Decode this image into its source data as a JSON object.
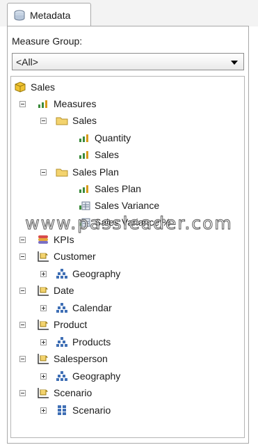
{
  "tab": {
    "label": "Metadata",
    "icon": "cube-stack-icon"
  },
  "measure_group": {
    "label": "Measure Group:",
    "selected": "<All>"
  },
  "tree": {
    "cube": "Sales",
    "measures": "Measures",
    "sales_folder": "Sales",
    "quantity": "Quantity",
    "sales_measure": "Sales",
    "sales_plan_folder": "Sales Plan",
    "sales_plan_measure": "Sales Plan",
    "sales_variance": "Sales Variance",
    "sales_variance_pct": "Sales Variance %",
    "kpis": "KPIs",
    "customer": "Customer",
    "customer_geography": "Geography",
    "date": "Date",
    "calendar": "Calendar",
    "product": "Product",
    "products": "Products",
    "salesperson": "Salesperson",
    "salesperson_geography": "Geography",
    "scenario": "Scenario",
    "scenario_attr": "Scenario"
  },
  "watermark": "www.passleader.com"
}
